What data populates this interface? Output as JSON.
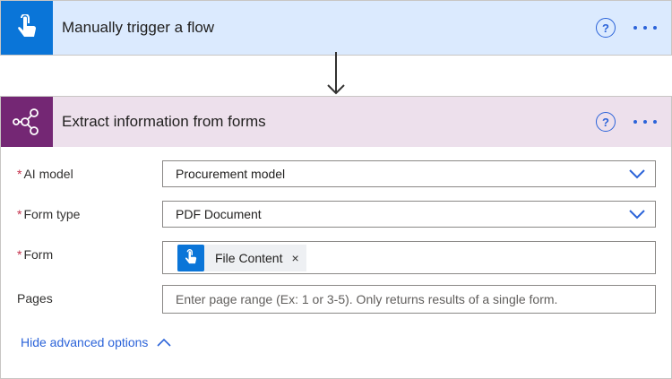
{
  "trigger": {
    "title": "Manually trigger a flow",
    "icon": "touch-icon",
    "color": "#0a75d8",
    "header_bg": "#dbeafe"
  },
  "action": {
    "title": "Extract information from forms",
    "icon": "ai-builder-icon",
    "color": "#742774",
    "header_bg": "#ede0ec",
    "fields": {
      "ai_model": {
        "required_mark": "*",
        "label": "AI model",
        "value": "Procurement model"
      },
      "form_type": {
        "required_mark": "*",
        "label": "Form type",
        "value": "PDF Document"
      },
      "form": {
        "required_mark": "*",
        "label": "Form",
        "token": {
          "label": "File Content",
          "remove": "×"
        }
      },
      "pages": {
        "label": "Pages",
        "placeholder": "Enter page range (Ex: 1 or 3-5). Only returns results of a single form."
      }
    },
    "advanced_label": "Hide advanced options"
  },
  "colors": {
    "accent": "#2b63d9",
    "required": "#c4314b"
  }
}
